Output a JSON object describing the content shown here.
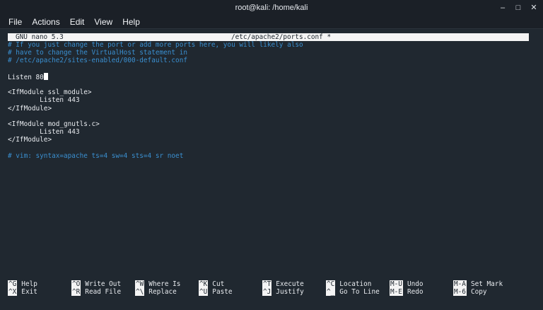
{
  "window": {
    "title": "root@kali: /home/kali",
    "controls": {
      "minimize": "‒",
      "maximize": "□",
      "close": "✕"
    }
  },
  "menu": [
    "File",
    "Actions",
    "Edit",
    "View",
    "Help"
  ],
  "nano": {
    "version": "GNU nano 5.3",
    "filename": "/etc/apache2/ports.conf *"
  },
  "editor_lines": [
    {
      "text": "# If you just change the port or add more ports here, you will likely also",
      "type": "comment"
    },
    {
      "text": "# have to change the VirtualHost statement in",
      "type": "comment"
    },
    {
      "text": "# /etc/apache2/sites-enabled/000-default.conf",
      "type": "comment"
    },
    {
      "text": "",
      "type": "normal"
    },
    {
      "text": "Listen 80",
      "type": "normal",
      "cursor": true
    },
    {
      "text": "",
      "type": "normal"
    },
    {
      "text": "<IfModule ssl_module>",
      "type": "normal"
    },
    {
      "text": "        Listen 443",
      "type": "normal"
    },
    {
      "text": "</IfModule>",
      "type": "normal"
    },
    {
      "text": "",
      "type": "normal"
    },
    {
      "text": "<IfModule mod_gnutls.c>",
      "type": "normal"
    },
    {
      "text": "        Listen 443",
      "type": "normal"
    },
    {
      "text": "</IfModule>",
      "type": "normal"
    },
    {
      "text": "",
      "type": "normal"
    },
    {
      "text": "# vim: syntax=apache ts=4 sw=4 sts=4 sr noet",
      "type": "comment"
    }
  ],
  "shortcuts": [
    {
      "key": "^G",
      "label": "Help"
    },
    {
      "key": "^X",
      "label": "Exit"
    },
    {
      "key": "^O",
      "label": "Write Out"
    },
    {
      "key": "^R",
      "label": "Read File"
    },
    {
      "key": "^W",
      "label": "Where Is"
    },
    {
      "key": "^\\",
      "label": "Replace"
    },
    {
      "key": "^K",
      "label": "Cut"
    },
    {
      "key": "^U",
      "label": "Paste"
    },
    {
      "key": "^T",
      "label": "Execute"
    },
    {
      "key": "^J",
      "label": "Justify"
    },
    {
      "key": "^C",
      "label": "Location"
    },
    {
      "key": "^_",
      "label": "Go To Line"
    },
    {
      "key": "M-U",
      "label": "Undo"
    },
    {
      "key": "M-E",
      "label": "Redo"
    },
    {
      "key": "M-A",
      "label": "Set Mark"
    },
    {
      "key": "M-6",
      "label": "Copy"
    }
  ],
  "colors": {
    "terminal_bg": "#202830",
    "comment": "#3a8fd0",
    "text": "#e8ebef",
    "bar_bg": "#f4f4f4"
  }
}
